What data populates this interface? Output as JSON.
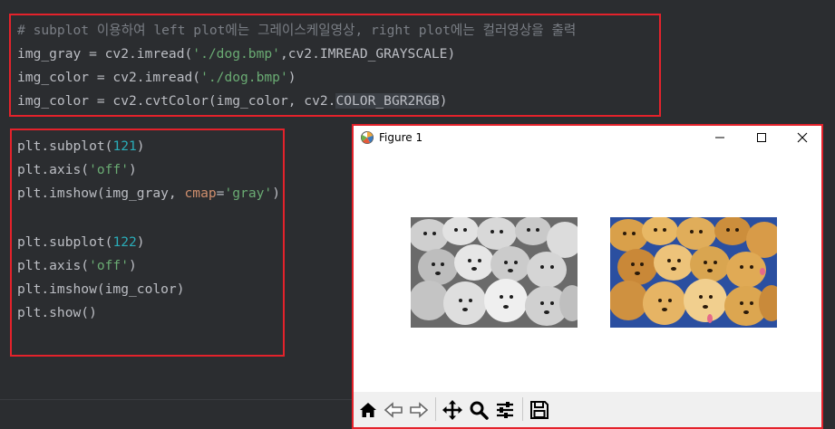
{
  "editor": {
    "block1": {
      "comment": "# subplot 이용하여 left plot에는 그레이스케일영상, right plot에는 컬러영상을 출력",
      "line2": {
        "a": "img_gray = cv2.imread(",
        "s": "'./dog.bmp'",
        "b": ",cv2.IMREAD_GRAYSCALE)"
      },
      "line3": {
        "a": "img_color = cv2.imread(",
        "s": "'./dog.bmp'",
        "b": ")"
      },
      "line4": {
        "a": "img_color = cv2.cvtColor(img_color, cv2.",
        "h": "COLOR_BGR2RGB",
        "b": ")"
      }
    },
    "block2": {
      "l1": {
        "a": "plt.subplot(",
        "n": "121",
        "b": ")"
      },
      "l2": {
        "a": "plt.axis(",
        "s": "'off'",
        "b": ")"
      },
      "l3": {
        "a": "plt.imshow(img_gray, ",
        "k": "cmap",
        "e": "=",
        "s": "'gray'",
        "b": ")"
      },
      "l5": {
        "a": "plt.subplot(",
        "n": "122",
        "b": ")"
      },
      "l6": {
        "a": "plt.axis(",
        "s": "'off'",
        "b": ")"
      },
      "l7": {
        "a": "plt.imshow(img_color)"
      },
      "l8": {
        "a": "plt.show()"
      }
    }
  },
  "figure_window": {
    "title": "Figure 1",
    "controls": [
      "minimize",
      "maximize",
      "close"
    ],
    "images": [
      {
        "name": "grayscale-puppies-image",
        "colormap": "gray"
      },
      {
        "name": "color-puppies-image",
        "colormap": "rgb"
      }
    ],
    "toolbar": [
      "home-icon",
      "back-icon",
      "forward-icon",
      "pan-icon",
      "zoom-icon",
      "configure-subplots-icon",
      "save-icon"
    ]
  },
  "colors": {
    "editor_bg": "#2b2d30",
    "code_text": "#bcbec4",
    "comment": "#7a7e85",
    "string": "#6aab73",
    "number": "#2aacb8",
    "keyword": "#cf8e6d",
    "annotation_red": "#e4222b"
  }
}
